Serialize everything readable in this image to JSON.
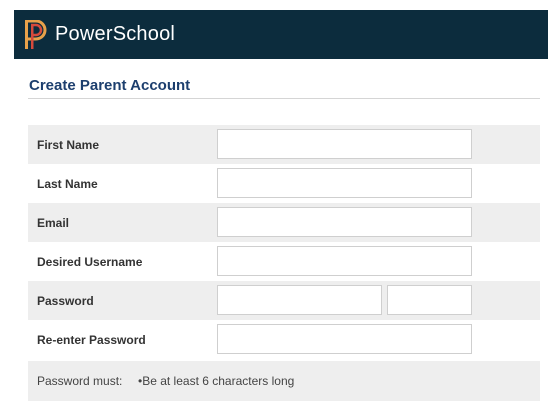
{
  "header": {
    "brand": "PowerSchool",
    "logo_icon": "powerschool-logo-icon",
    "bg": "#0c2c3d"
  },
  "page": {
    "title": "Create Parent Account"
  },
  "form": {
    "first_name": {
      "label": "First Name",
      "value": "",
      "placeholder": ""
    },
    "last_name": {
      "label": "Last Name",
      "value": "",
      "placeholder": ""
    },
    "email": {
      "label": "Email",
      "value": "",
      "placeholder": ""
    },
    "username": {
      "label": "Desired Username",
      "value": "",
      "placeholder": ""
    },
    "password": {
      "label": "Password",
      "value": "",
      "placeholder": ""
    },
    "reenter": {
      "label": "Re-enter Password",
      "value": "",
      "placeholder": ""
    }
  },
  "password_rules": {
    "label": "Password must:",
    "rule": "•Be at least 6 characters long"
  },
  "colors": {
    "title": "#1d3f6e",
    "row_shade": "#eeeeee"
  }
}
